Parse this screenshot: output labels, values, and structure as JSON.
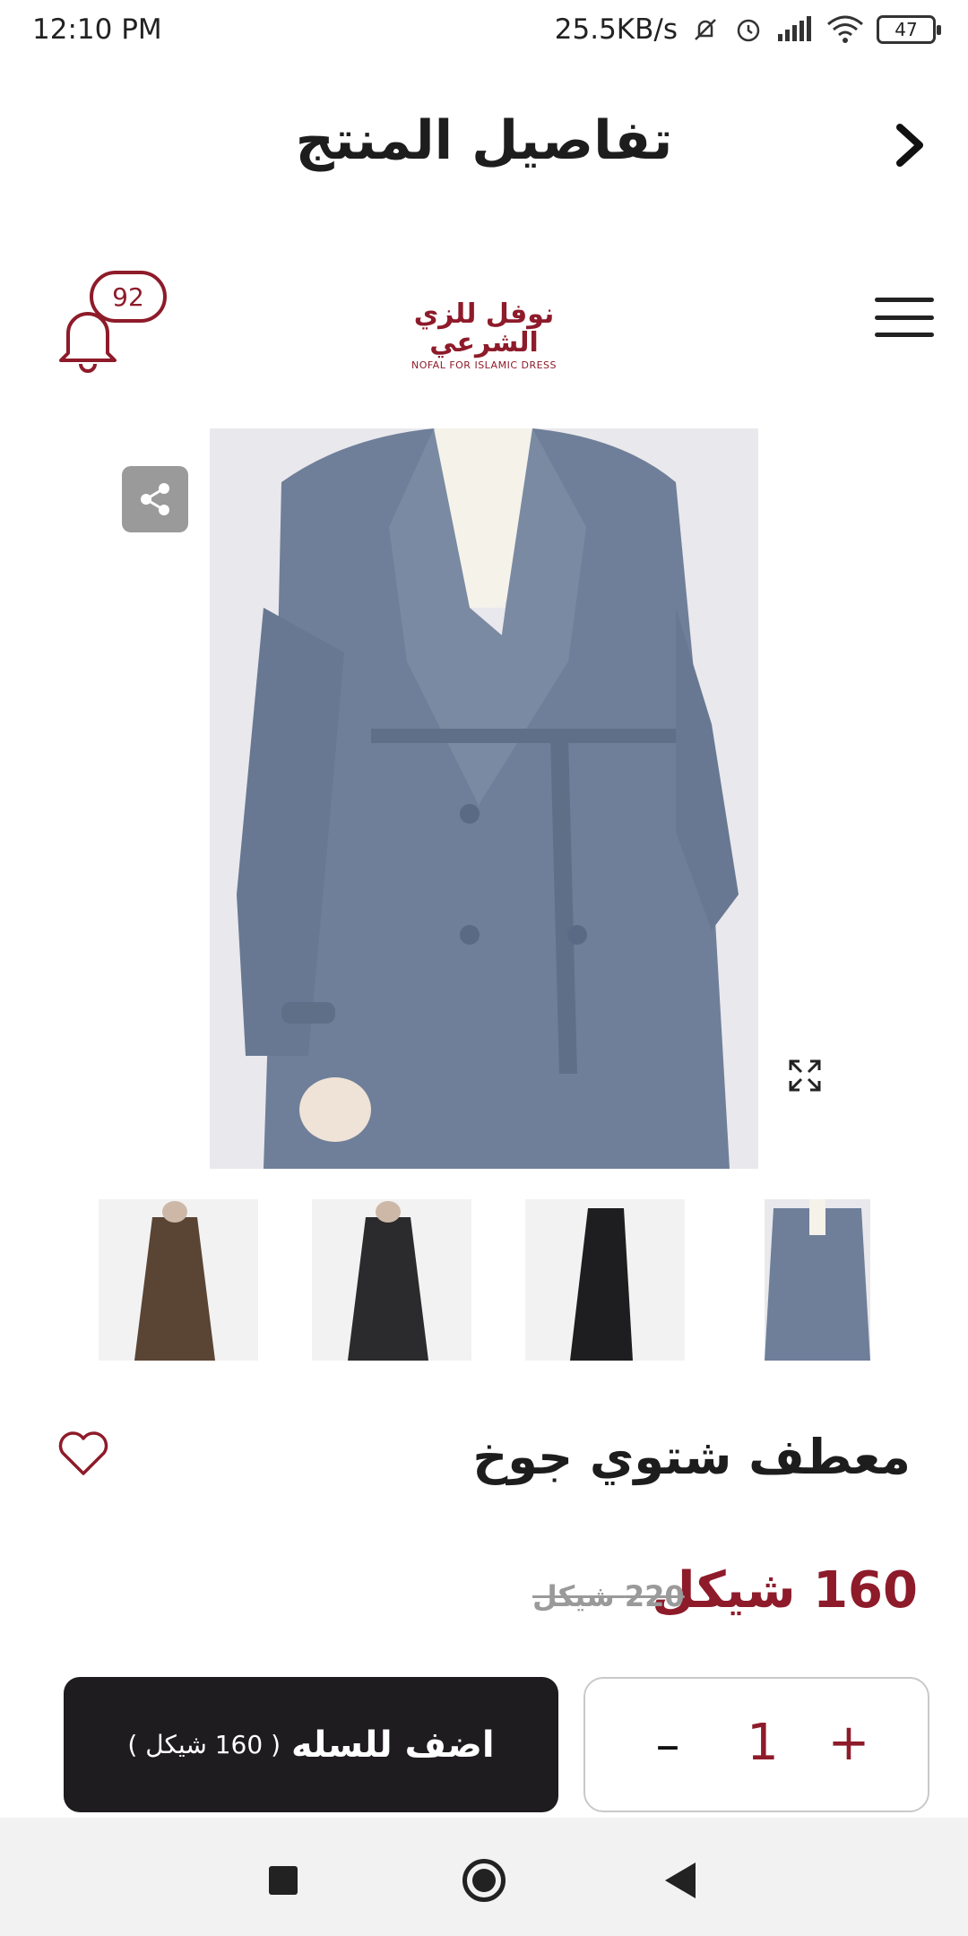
{
  "status_bar": {
    "time": "12:10 PM",
    "network_speed": "25.5KB/s",
    "battery": "47",
    "icons": [
      "mute-bell-icon",
      "alarm-icon",
      "signal-icon",
      "wifi-icon",
      "battery-icon"
    ]
  },
  "header": {
    "title": "تفاصيل المنتج",
    "back_icon": "chevron-right-icon"
  },
  "brand": {
    "logo_ar": "نوفل للزي الشرعي",
    "logo_en": "NOFAL FOR ISLAMIC DRESS",
    "notification_count": "92",
    "menu_icon": "hamburger-menu-icon"
  },
  "gallery": {
    "main_image": "blue-gray-wool-coat",
    "share_icon": "share-icon",
    "expand_icon": "expand-icon",
    "thumbnails": [
      "brown-coat",
      "black-coat",
      "black-coat-side",
      "blue-gray-coat"
    ]
  },
  "product": {
    "name": "معطف شتوي جوخ",
    "price_now": "160 شيكل",
    "price_old": "220 شيكل",
    "favorite_icon": "heart-icon"
  },
  "cart": {
    "add_label": "اضف للسله",
    "add_price": "( 160 شيكل )",
    "quantity": "1",
    "minus": "–",
    "plus": "+"
  },
  "colors": {
    "accent": "#8e1b2a",
    "button_dark": "#1f1c1f"
  }
}
